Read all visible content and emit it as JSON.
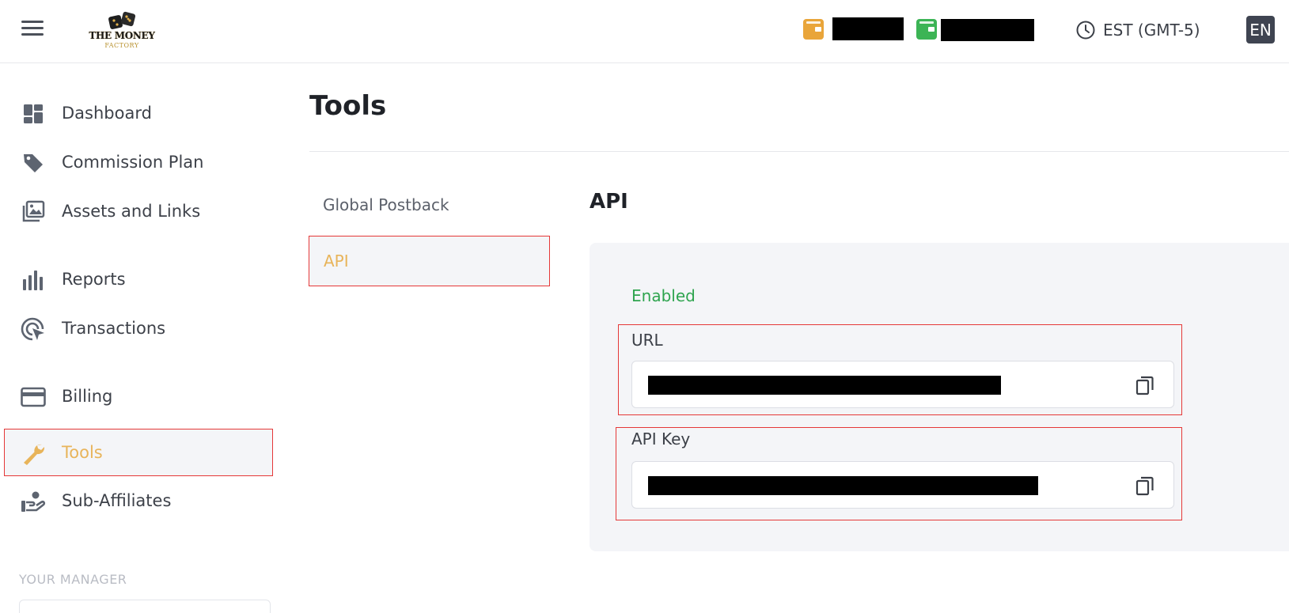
{
  "header": {
    "brand": {
      "title": "THE MONEY",
      "subtitle": "FACTORY"
    },
    "wallets": [
      {
        "icon": "wallet-icon",
        "color": "#e9a53a",
        "balance": ""
      },
      {
        "icon": "wallet-icon",
        "color": "#3cb455",
        "balance": ""
      }
    ],
    "timezone": "EST (GMT-5)",
    "language": "EN"
  },
  "sidebar": {
    "items": [
      {
        "label": "Dashboard",
        "icon": "dashboard-icon"
      },
      {
        "label": "Commission Plan",
        "icon": "tag-icon"
      },
      {
        "label": "Assets and Links",
        "icon": "images-icon"
      },
      {
        "label": "Reports",
        "icon": "bar-chart-icon"
      },
      {
        "label": "Transactions",
        "icon": "target-cursor-icon"
      },
      {
        "label": "Billing",
        "icon": "credit-card-icon"
      },
      {
        "label": "Tools",
        "icon": "wrench-icon",
        "active": true
      },
      {
        "label": "Sub-Affiliates",
        "icon": "hand-person-icon"
      }
    ],
    "manager_label": "YOUR MANAGER"
  },
  "main": {
    "title": "Tools",
    "subnav": [
      {
        "label": "Global Postback"
      },
      {
        "label": "API",
        "active": true
      }
    ],
    "section_title": "API",
    "status": "Enabled",
    "fields": {
      "url": {
        "label": "URL",
        "value": ""
      },
      "api_key": {
        "label": "API Key",
        "value": ""
      }
    }
  },
  "colors": {
    "accent": "#e8b45a",
    "status_enabled": "#2fa44f",
    "highlight_border": "#e53838"
  }
}
